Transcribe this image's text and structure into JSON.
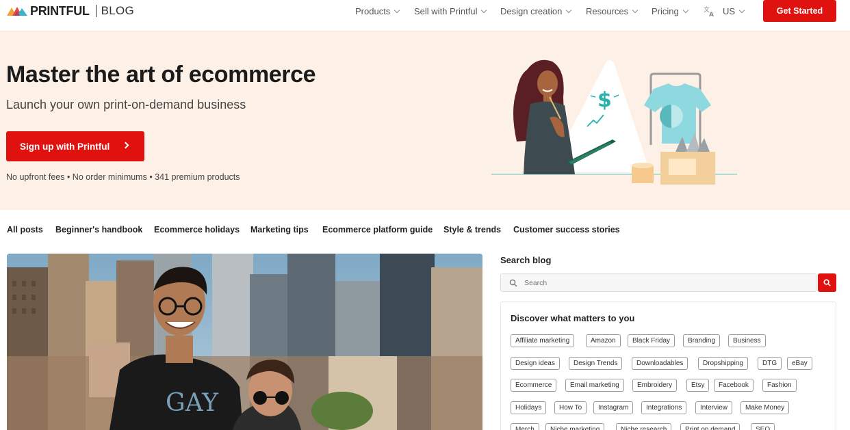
{
  "header": {
    "logo_word": "PRINTFUL",
    "logo_section": "BLOG",
    "menu": [
      {
        "label": "Products"
      },
      {
        "label": "Sell with Printful"
      },
      {
        "label": "Design creation"
      },
      {
        "label": "Resources"
      },
      {
        "label": "Pricing"
      },
      {
        "label": "US"
      }
    ],
    "cta": "Get Started",
    "icons": {
      "logo": "printful-logo-mark",
      "language": "translate-icon",
      "dropdown": "chevron-down-icon"
    }
  },
  "hero": {
    "title": "Master the art of ecommerce",
    "subtitle": "Launch your own print-on-demand business",
    "button": "Sign up with Printful",
    "note": "No upfront fees • No order minimums • 341 premium products",
    "illustration_symbol": "$"
  },
  "categories": [
    "All posts",
    "Beginner's handbook",
    "Ecommerce holidays",
    "Marketing tips",
    "Ecommerce platform guide",
    "Style & trends",
    "Customer success stories"
  ],
  "sidebar": {
    "search_title": "Search blog",
    "search_placeholder": "Search",
    "topics_title": "Discover what matters to you",
    "tags": [
      "Affiliate marketing",
      "Amazon",
      "Black Friday",
      "Branding",
      "Business",
      "Design ideas",
      "Design Trends",
      "Downloadables",
      "Dropshipping",
      "DTG",
      "eBay",
      "Ecommerce",
      "Email marketing",
      "Embroidery",
      "Etsy",
      "Facebook",
      "Fashion",
      "Holidays",
      "How To",
      "Instagram",
      "Integrations",
      "Interview",
      "Make Money",
      "Merch",
      "Niche marketing",
      "Niche research",
      "Print on demand",
      "SEO"
    ]
  },
  "colors": {
    "accent": "#e0120f",
    "hero_bg": "#fdf0e6",
    "teal": "#5fc9c7"
  }
}
